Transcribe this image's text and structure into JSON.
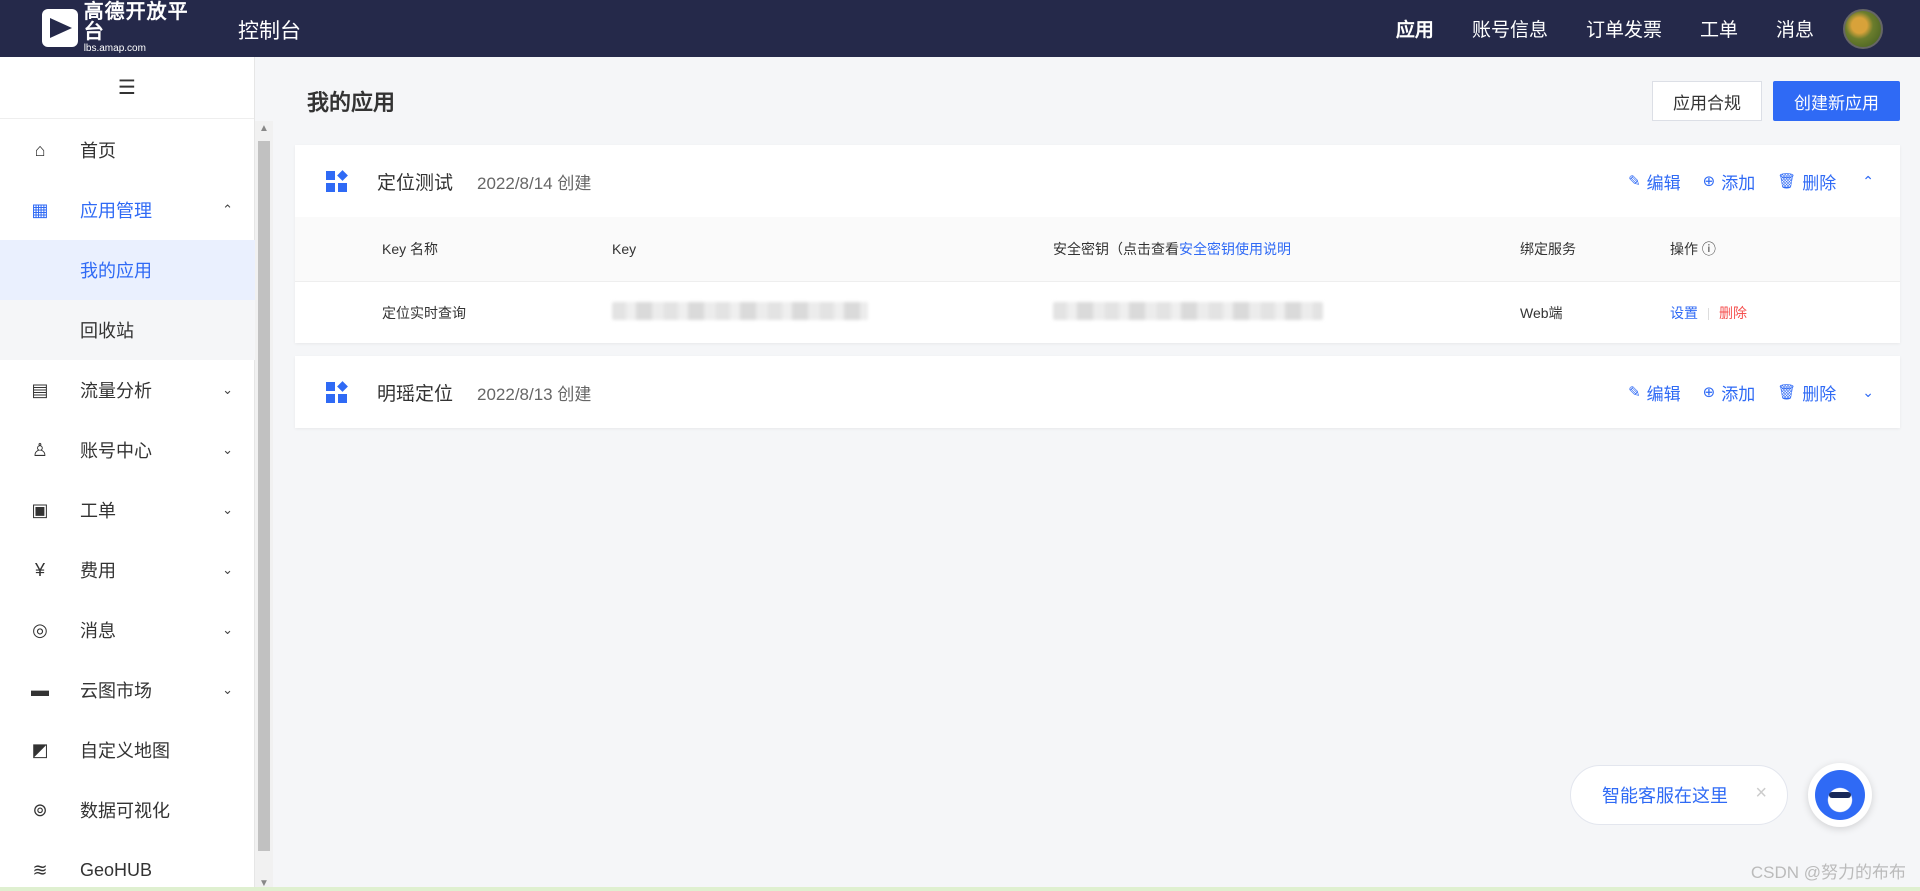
{
  "header": {
    "logo_title": "高德开放平台",
    "logo_sub": "lbs.amap.com",
    "console_title": "控制台",
    "nav": [
      "应用",
      "账号信息",
      "订单发票",
      "工单",
      "消息"
    ]
  },
  "sidebar": {
    "toggle_icon": "☰",
    "items": [
      {
        "label": "首页",
        "icon": "home-icon",
        "glyph": "⌂"
      },
      {
        "label": "应用管理",
        "icon": "grid-icon",
        "glyph": "▦",
        "chevron": "⌃"
      },
      {
        "label": "流量分析",
        "icon": "chart-icon",
        "glyph": "▤",
        "chevron": "⌄"
      },
      {
        "label": "账号中心",
        "icon": "user-icon",
        "glyph": "♙",
        "chevron": "⌄"
      },
      {
        "label": "工单",
        "icon": "ticket-icon",
        "glyph": "▣",
        "chevron": "⌄"
      },
      {
        "label": "费用",
        "icon": "yen-icon",
        "glyph": "¥",
        "chevron": "⌄"
      },
      {
        "label": "消息",
        "icon": "message-icon",
        "glyph": "◎",
        "chevron": "⌄"
      },
      {
        "label": "云图市场",
        "icon": "store-icon",
        "glyph": "▬",
        "chevron": "⌄"
      },
      {
        "label": "自定义地图",
        "icon": "map-icon",
        "glyph": "◩"
      },
      {
        "label": "数据可视化",
        "icon": "visual-icon",
        "glyph": "⊚"
      },
      {
        "label": "GeoHUB",
        "icon": "layers-icon",
        "glyph": "≋"
      }
    ],
    "sub_items": [
      "我的应用",
      "回收站"
    ]
  },
  "main": {
    "title": "我的应用",
    "compliance_btn": "应用合规",
    "create_btn": "创建新应用",
    "actions": {
      "edit": "编辑",
      "add": "添加",
      "delete": "删除"
    },
    "apps": [
      {
        "name": "定位测试",
        "date": "2022/8/14 创建"
      },
      {
        "name": "明瑶定位",
        "date": "2022/8/13 创建"
      }
    ],
    "table": {
      "headers": {
        "key_name": "Key 名称",
        "key": "Key",
        "secret_prefix": "安全密钥（点击查看",
        "secret_link": "安全密钥使用说明",
        "service": "绑定服务",
        "ops": "操作"
      },
      "row": {
        "key_name": "定位实时查询",
        "service": "Web端",
        "settings": "设置",
        "delete": "删除"
      }
    }
  },
  "chat": {
    "text": "智能客服在这里",
    "close": "×"
  },
  "watermark": "CSDN @努力的布布"
}
